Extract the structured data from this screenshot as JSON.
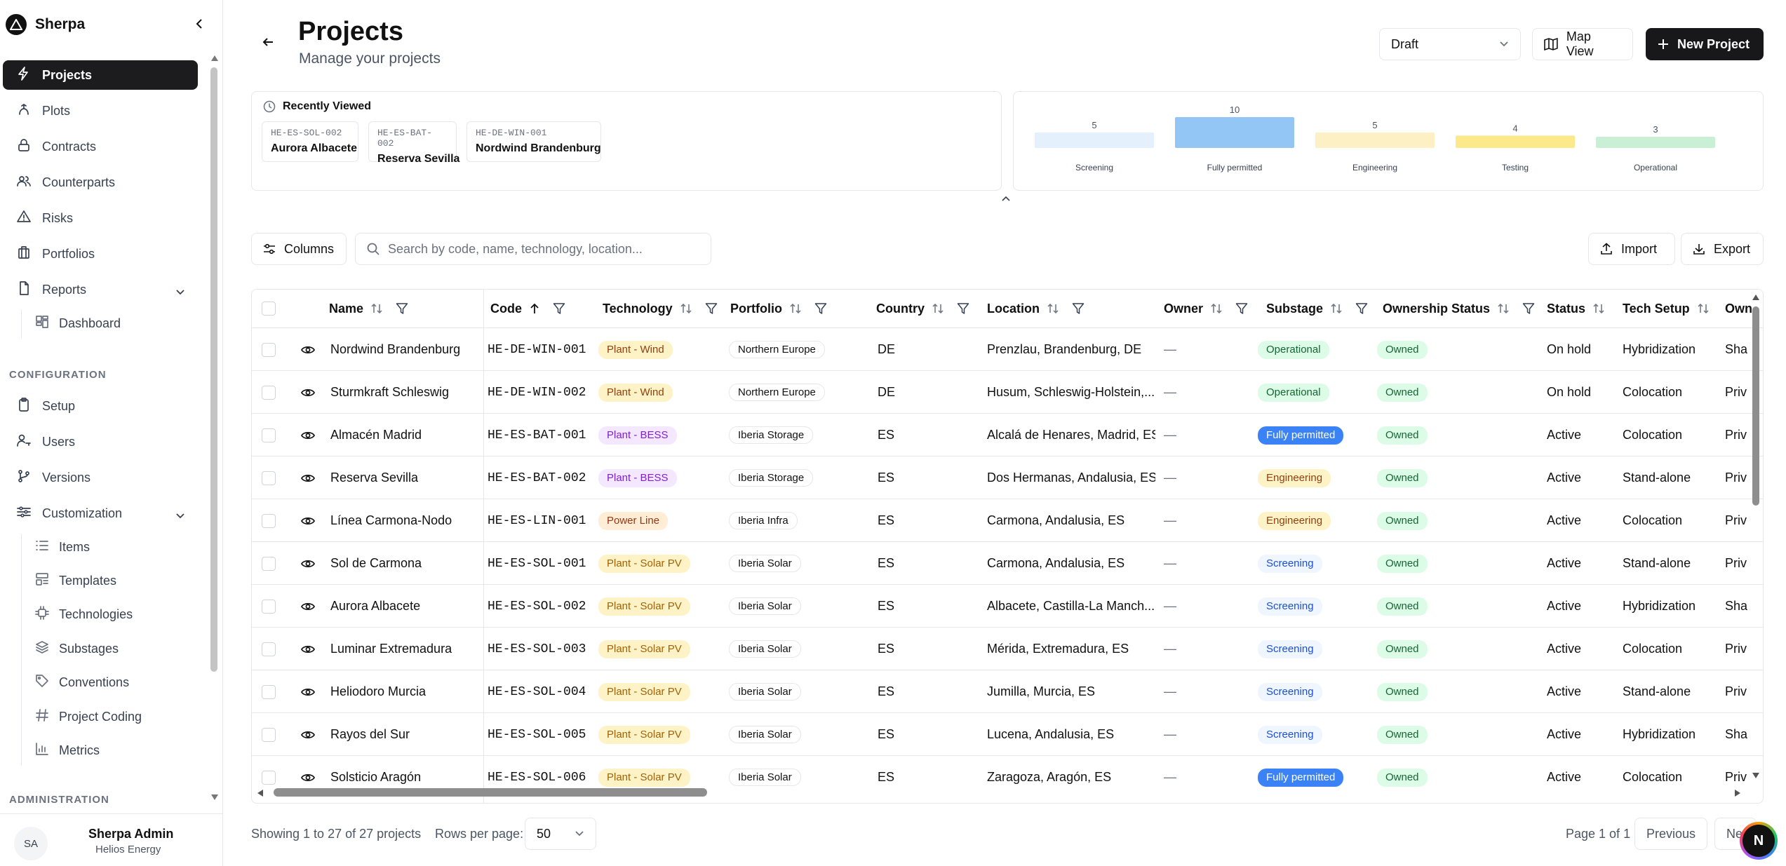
{
  "app": {
    "name": "Sherpa"
  },
  "sidebar": {
    "items": [
      {
        "label": "Projects",
        "icon": "bolt-icon"
      },
      {
        "label": "Plots",
        "icon": "plots-icon"
      },
      {
        "label": "Contracts",
        "icon": "lock-icon"
      },
      {
        "label": "Counterparts",
        "icon": "users-icon"
      },
      {
        "label": "Risks",
        "icon": "warning-icon"
      },
      {
        "label": "Portfolios",
        "icon": "building-icon"
      },
      {
        "label": "Reports",
        "icon": "file-icon"
      }
    ],
    "reports_sub": [
      {
        "label": "Dashboard",
        "icon": "dashboard-icon"
      }
    ],
    "configuration_label": "CONFIGURATION",
    "config_items": [
      {
        "label": "Setup",
        "icon": "clipboard-icon"
      },
      {
        "label": "Users",
        "icon": "user-key-icon"
      },
      {
        "label": "Versions",
        "icon": "branch-icon"
      },
      {
        "label": "Customization",
        "icon": "sliders-icon"
      }
    ],
    "customization_sub": [
      {
        "label": "Items",
        "icon": "list-icon"
      },
      {
        "label": "Templates",
        "icon": "template-icon"
      },
      {
        "label": "Technologies",
        "icon": "chip-icon"
      },
      {
        "label": "Substages",
        "icon": "stack-icon"
      },
      {
        "label": "Conventions",
        "icon": "tag-icon"
      },
      {
        "label": "Project Coding",
        "icon": "hash-icon"
      },
      {
        "label": "Metrics",
        "icon": "chart-icon"
      }
    ],
    "administration_label": "ADMINISTRATION",
    "user": {
      "initials": "SA",
      "name": "Sherpa Admin",
      "org": "Helios Energy"
    }
  },
  "header": {
    "title": "Projects",
    "subtitle": "Manage your projects",
    "status_select": "Draft",
    "map_view_label": "Map View",
    "new_project_label": "New Project"
  },
  "recently_viewed": {
    "title": "Recently Viewed",
    "items": [
      {
        "code": "HE-ES-SOL-002",
        "name": "Aurora Albacete"
      },
      {
        "code": "HE-ES-BAT-002",
        "name": "Reserva Sevilla"
      },
      {
        "code": "HE-DE-WIN-001",
        "name": "Nordwind Brandenburg"
      }
    ]
  },
  "chart_data": {
    "type": "bar",
    "categories": [
      "Screening",
      "Fully permitted",
      "Engineering",
      "Testing",
      "Operational"
    ],
    "values": [
      5,
      10,
      5,
      4,
      3
    ],
    "colors": [
      "#e4f1fc",
      "#93c5f5",
      "#fdf0c4",
      "#fbe98c",
      "#c9f0d4"
    ],
    "ylim": [
      0,
      10
    ]
  },
  "toolbar": {
    "columns_label": "Columns",
    "search_placeholder": "Search by code, name, technology, location...",
    "import_label": "Import",
    "export_label": "Export"
  },
  "table": {
    "headers": [
      "Name",
      "Code",
      "Technology",
      "Portfolio",
      "Country",
      "Location",
      "Owner",
      "Substage",
      "Ownership Status",
      "Status",
      "Tech Setup",
      "Own"
    ],
    "rows": [
      {
        "name": "Nordwind Brandenburg",
        "code": "HE-DE-WIN-001",
        "tech": "Plant - Wind",
        "portfolio": "Northern Europe",
        "country": "DE",
        "location": "Prenzlau, Brandenburg, DE",
        "owner": "—",
        "substage": "Operational",
        "ownership": "Owned",
        "status": "On hold",
        "setup": "Hybridization",
        "own": "Sha"
      },
      {
        "name": "Sturmkraft Schleswig",
        "code": "HE-DE-WIN-002",
        "tech": "Plant - Wind",
        "portfolio": "Northern Europe",
        "country": "DE",
        "location": "Husum, Schleswig-Holstein,...",
        "owner": "—",
        "substage": "Operational",
        "ownership": "Owned",
        "status": "On hold",
        "setup": "Colocation",
        "own": "Priv"
      },
      {
        "name": "Almacén Madrid",
        "code": "HE-ES-BAT-001",
        "tech": "Plant - BESS",
        "portfolio": "Iberia Storage",
        "country": "ES",
        "location": "Alcalá de Henares, Madrid, ES",
        "owner": "—",
        "substage": "Fully permitted",
        "ownership": "Owned",
        "status": "Active",
        "setup": "Colocation",
        "own": "Priv"
      },
      {
        "name": "Reserva Sevilla",
        "code": "HE-ES-BAT-002",
        "tech": "Plant - BESS",
        "portfolio": "Iberia Storage",
        "country": "ES",
        "location": "Dos Hermanas, Andalusia, ES",
        "owner": "—",
        "substage": "Engineering",
        "ownership": "Owned",
        "status": "Active",
        "setup": "Stand-alone",
        "own": "Priv"
      },
      {
        "name": "Línea Carmona-Nodo",
        "code": "HE-ES-LIN-001",
        "tech": "Power Line",
        "portfolio": "Iberia Infra",
        "country": "ES",
        "location": "Carmona, Andalusia, ES",
        "owner": "—",
        "substage": "Engineering",
        "ownership": "Owned",
        "status": "Active",
        "setup": "Colocation",
        "own": "Priv"
      },
      {
        "name": "Sol de Carmona",
        "code": "HE-ES-SOL-001",
        "tech": "Plant - Solar PV",
        "portfolio": "Iberia Solar",
        "country": "ES",
        "location": "Carmona, Andalusia, ES",
        "owner": "—",
        "substage": "Screening",
        "ownership": "Owned",
        "status": "Active",
        "setup": "Stand-alone",
        "own": "Priv"
      },
      {
        "name": "Aurora Albacete",
        "code": "HE-ES-SOL-002",
        "tech": "Plant - Solar PV",
        "portfolio": "Iberia Solar",
        "country": "ES",
        "location": "Albacete, Castilla-La Manch...",
        "owner": "—",
        "substage": "Screening",
        "ownership": "Owned",
        "status": "Active",
        "setup": "Hybridization",
        "own": "Sha"
      },
      {
        "name": "Luminar Extremadura",
        "code": "HE-ES-SOL-003",
        "tech": "Plant - Solar PV",
        "portfolio": "Iberia Solar",
        "country": "ES",
        "location": "Mérida, Extremadura, ES",
        "owner": "—",
        "substage": "Screening",
        "ownership": "Owned",
        "status": "Active",
        "setup": "Colocation",
        "own": "Priv"
      },
      {
        "name": "Heliodoro Murcia",
        "code": "HE-ES-SOL-004",
        "tech": "Plant - Solar PV",
        "portfolio": "Iberia Solar",
        "country": "ES",
        "location": "Jumilla, Murcia, ES",
        "owner": "—",
        "substage": "Screening",
        "ownership": "Owned",
        "status": "Active",
        "setup": "Stand-alone",
        "own": "Priv"
      },
      {
        "name": "Rayos del Sur",
        "code": "HE-ES-SOL-005",
        "tech": "Plant - Solar PV",
        "portfolio": "Iberia Solar",
        "country": "ES",
        "location": "Lucena, Andalusia, ES",
        "owner": "—",
        "substage": "Screening",
        "ownership": "Owned",
        "status": "Active",
        "setup": "Hybridization",
        "own": "Sha"
      },
      {
        "name": "Solsticio Aragón",
        "code": "HE-ES-SOL-006",
        "tech": "Plant - Solar PV",
        "portfolio": "Iberia Solar",
        "country": "ES",
        "location": "Zaragoza, Aragón, ES",
        "owner": "—",
        "substage": "Fully permitted",
        "ownership": "Owned",
        "status": "Active",
        "setup": "Colocation",
        "own": "Priv"
      }
    ]
  },
  "footer": {
    "showing": "Showing 1 to 27 of 27 projects",
    "rows_per_page_label": "Rows per page:",
    "rows_per_page": "50",
    "page_info": "Page 1 of 1",
    "previous": "Previous",
    "next": "Ne",
    "fab_letter": "N"
  },
  "colors": {
    "tech": {
      "Plant - Wind": {
        "bg": "#fdf3c7",
        "fg": "#92400e"
      },
      "Plant - BESS": {
        "bg": "#f3e8ff",
        "fg": "#7e22ce"
      },
      "Power Line": {
        "bg": "#ffedd5",
        "fg": "#9a3412"
      },
      "Plant - Solar PV": {
        "bg": "#fef3c7",
        "fg": "#a16207"
      }
    },
    "substage": {
      "Operational": {
        "bg": "#dcfce7",
        "fg": "#166534"
      },
      "Fully permitted": {
        "bg": "#3b82f6",
        "fg": "#ffffff"
      },
      "Engineering": {
        "bg": "#fef3c7",
        "fg": "#92400e"
      },
      "Screening": {
        "bg": "#eff6ff",
        "fg": "#1d4ed8"
      }
    },
    "owned": {
      "bg": "#dcfce7",
      "fg": "#166534"
    }
  }
}
